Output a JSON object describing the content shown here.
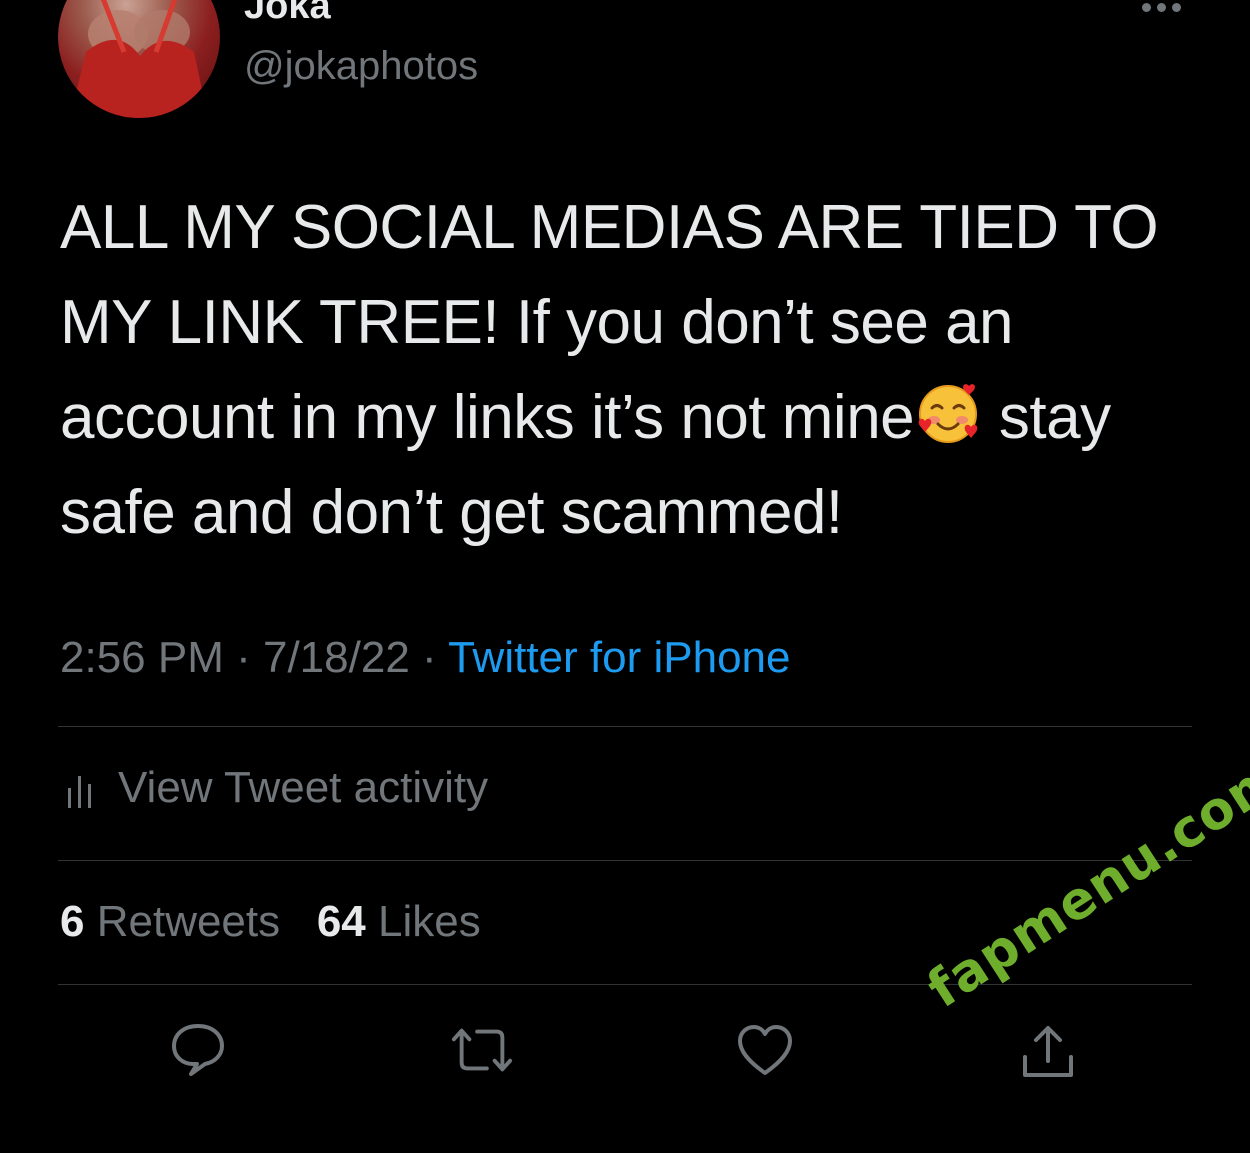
{
  "author": {
    "display_name": "Joka",
    "handle": "@jokaphotos",
    "avatar_icon": "profile-photo"
  },
  "tweet": {
    "text_part1": "ALL MY SOCIAL MEDIAS ARE TIED TO MY LINK TREE! If you don’t see an account in my links it’s not mine",
    "emoji": "smiling-face-with-hearts",
    "text_part2": " stay safe and don’t get scammed!"
  },
  "meta": {
    "time": "2:56 PM",
    "separator": " · ",
    "date": "7/18/22",
    "source": "Twitter for iPhone"
  },
  "activity": {
    "label": "View Tweet activity",
    "icon": "bar-chart-icon"
  },
  "stats": {
    "retweets_count": "6",
    "retweets_label": "Retweets",
    "likes_count": "64",
    "likes_label": "Likes"
  },
  "actions": [
    {
      "name": "reply",
      "icon": "speech-bubble-icon"
    },
    {
      "name": "retweet",
      "icon": "retweet-arrows-icon"
    },
    {
      "name": "like",
      "icon": "heart-icon"
    },
    {
      "name": "share",
      "icon": "share-upload-icon"
    }
  ],
  "watermark": "fapmenu.com",
  "colors": {
    "background": "#000000",
    "text_primary": "#e7e9ea",
    "text_secondary": "#71767b",
    "link": "#1d9bf0",
    "divider": "#2f3336",
    "watermark": "#6fae2c"
  }
}
